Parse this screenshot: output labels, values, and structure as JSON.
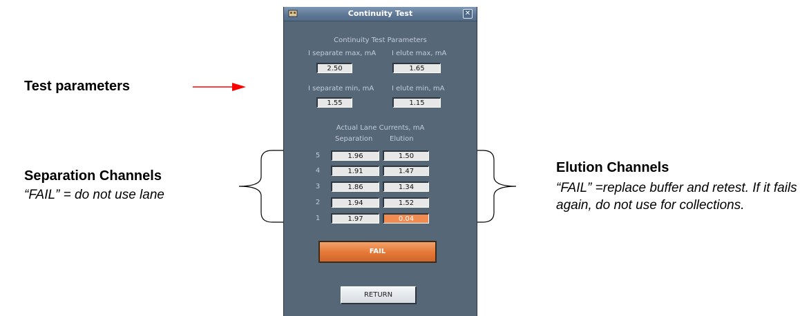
{
  "annotations": {
    "test_parameters": "Test parameters",
    "separation_title": "Separation Channels",
    "separation_note": "“FAIL” = do not use lane",
    "elution_title": "Elution Channels",
    "elution_note": "“FAIL” =replace buffer and retest.  If it fails again, do not use for collections."
  },
  "window": {
    "title": "Continuity Test",
    "close_glyph": "✕"
  },
  "parameters": {
    "heading": "Continuity Test Parameters",
    "i_separate_max": {
      "label": "I separate max, mA",
      "value": "2.50"
    },
    "i_elute_max": {
      "label": "I elute max, mA",
      "value": "1.65"
    },
    "i_separate_min": {
      "label": "I separate min, mA",
      "value": "1.55"
    },
    "i_elute_min": {
      "label": "I elute min, mA",
      "value": "1.15"
    }
  },
  "lanes": {
    "heading": "Actual Lane Currents, mA",
    "col_separation": "Separation",
    "col_elution": "Elution",
    "rows": [
      {
        "lane": "5",
        "separation": "1.96",
        "elution": "1.50"
      },
      {
        "lane": "4",
        "separation": "1.91",
        "elution": "1.47"
      },
      {
        "lane": "3",
        "separation": "1.86",
        "elution": "1.34"
      },
      {
        "lane": "2",
        "separation": "1.94",
        "elution": "1.52"
      },
      {
        "lane": "1",
        "separation": "1.97",
        "elution": "0.04"
      }
    ]
  },
  "result": {
    "status": "FAIL"
  },
  "buttons": {
    "return": "RETURN"
  },
  "colors": {
    "panel": "#566778",
    "fail_orange": "#e57736",
    "arrow_red": "#ff0000"
  }
}
